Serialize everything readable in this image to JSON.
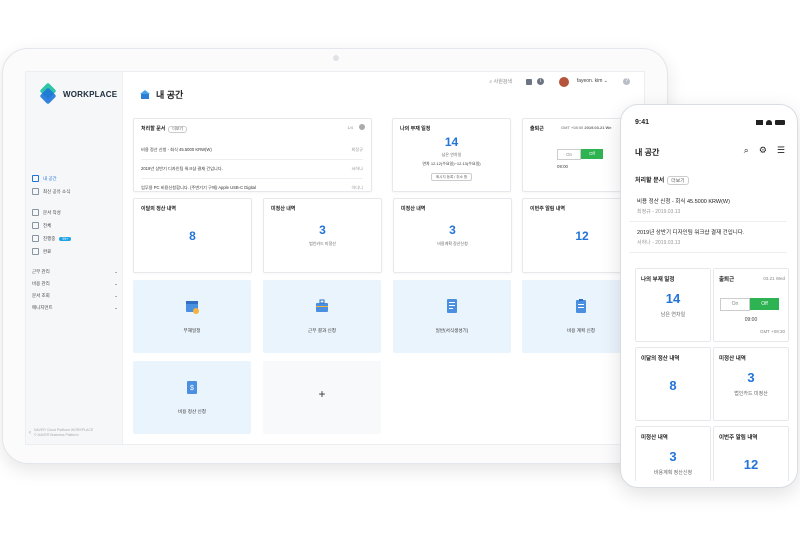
{
  "colors": {
    "accent": "#2374d8",
    "toggle_on": "#2db352",
    "tile_bg": "#eaf4fd"
  },
  "app": {
    "logo": "WORKPLACE",
    "page_title": "내 공간",
    "sidebar": {
      "items": [
        "내 공간",
        "최신 공유 소식"
      ],
      "items2": [
        "문서 작성",
        "전체",
        "진행중",
        "완료"
      ],
      "badge": "99+",
      "groups": [
        "근무 관리",
        "비용 관리",
        "문서 조회",
        "매니지먼트"
      ],
      "footer1": "NAVER Cloud Platform WORKPLACE",
      "footer2": "© NAVER Business Platform"
    },
    "topbar": {
      "search": "사원검색",
      "user": "fayeon. kim"
    },
    "docs": {
      "title": "처리할 문서",
      "more": "더보기",
      "count": "1/4",
      "rows": [
        {
          "text": "비용 정산 신청 - 회식 45.5000 KRW(W)",
          "by": "최정규"
        },
        {
          "text": "2019년 상반기 디자인팀 워크샵 결재 건입니다.",
          "by": "서하나"
        },
        {
          "text": "업무용 PC 비용신청합니다. (주변기기 구매) Apple USB-C Digital",
          "by": "이다니"
        }
      ]
    },
    "absence": {
      "title": "나의 부재 일정",
      "num": "14",
      "sub": "남은 연차일",
      "line": "연차 12.12(수요일)~12.13(수요일)",
      "btn": "메시지 등록 / 취소 함"
    },
    "attendance": {
      "title": "출퇴근",
      "tz": "GMT +08:00",
      "date": "2019.03.21 We",
      "off": "On",
      "on": "Off",
      "time": "09:00"
    },
    "stats": [
      {
        "title": "이달의 정산 내역",
        "num": "8",
        "sub": ""
      },
      {
        "title": "미정산 내역",
        "num": "3",
        "sub": "법인카드 미정산"
      },
      {
        "title": "미정산 내역",
        "num": "3",
        "sub": "비용계획 정산신청"
      },
      {
        "title": "이번주 알림 내역",
        "num": "12",
        "sub": ""
      }
    ],
    "tiles": [
      "부재일정",
      "근무 결과 신청",
      "일반(서식생성기)",
      "비용 계획 신청",
      "비용 정산 신청"
    ],
    "add": "+"
  },
  "phone": {
    "time": "9:41",
    "title": "내 공간",
    "section": "처리할 문서",
    "more": "더보기",
    "rows": [
      {
        "text": "비용 정산 신청 - 회식 45.5000 KRW(W)",
        "sub": "최정규 - 2019.03.13"
      },
      {
        "text": "2019년 상반기 디자인팀 워크샵 결재 건입니다.",
        "sub": "서하나 - 2019.03.13"
      }
    ],
    "absence": {
      "title": "나의 부재 일정",
      "num": "14",
      "sub": "남은 연차일"
    },
    "attendance": {
      "title": "출퇴근",
      "date": "03.21 Wed",
      "off": "On",
      "on": "Off",
      "time": "09:00",
      "tz": "GMT +08:30"
    },
    "stats": [
      {
        "title": "이달의 정산 내역",
        "num": "8",
        "sub": ""
      },
      {
        "title": "미정산 내역",
        "num": "3",
        "sub": "법인카드 미정산"
      },
      {
        "title": "미정산 내역",
        "num": "3",
        "sub": "비용계획 정산신청"
      },
      {
        "title": "이번주 알림 내역",
        "num": "12",
        "sub": ""
      }
    ]
  }
}
